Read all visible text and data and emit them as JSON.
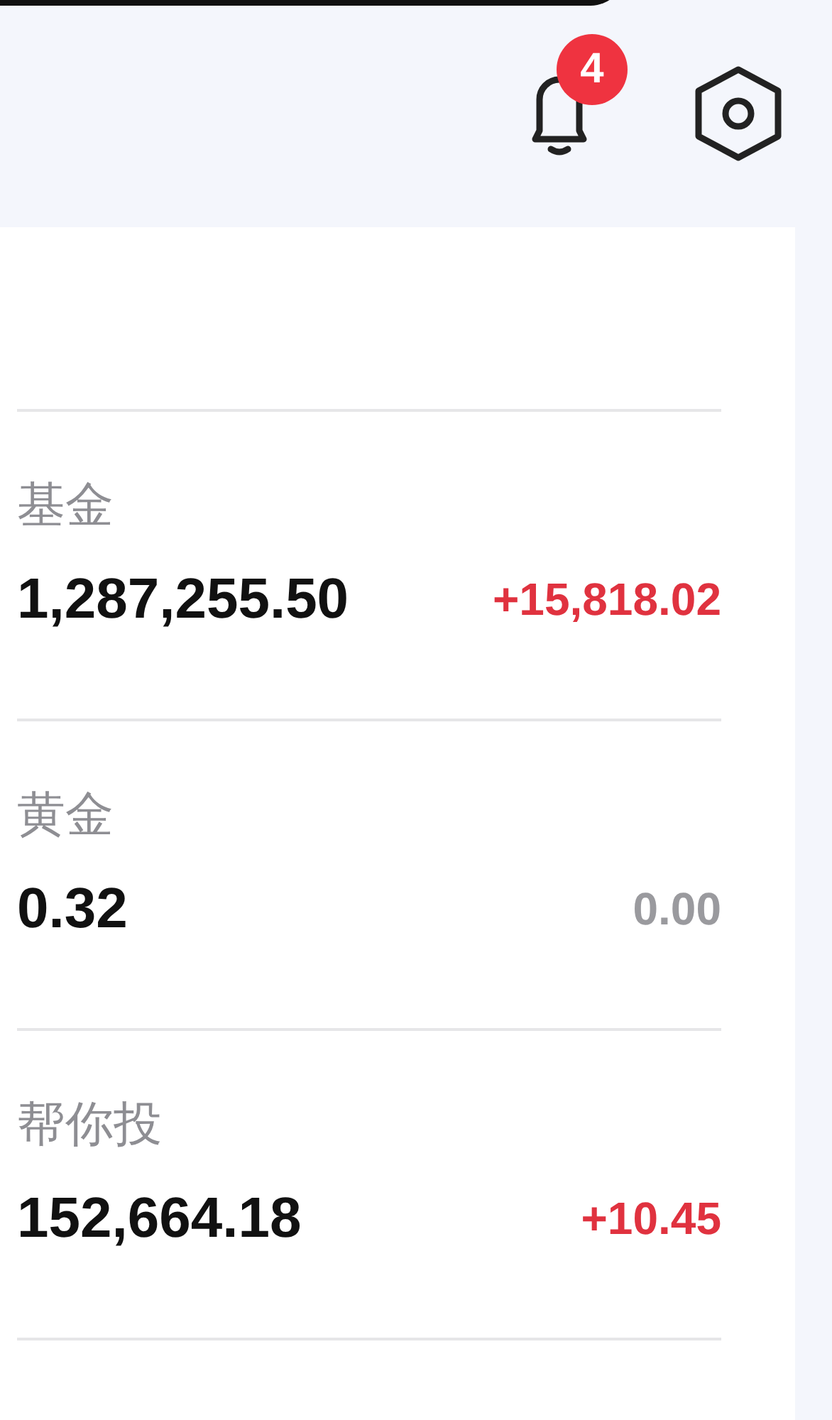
{
  "notifications": {
    "count": "4"
  },
  "assets": [
    {
      "label": "基金",
      "amount": "1,287,255.50",
      "change": "+15,818.02",
      "color": "#e0323f"
    },
    {
      "label": "黄金",
      "amount": "0.32",
      "change": "0.00",
      "color": "#9a9a9e"
    },
    {
      "label": "帮你投",
      "amount": "152,664.18",
      "change": "+10.45",
      "color": "#e0323f"
    }
  ]
}
